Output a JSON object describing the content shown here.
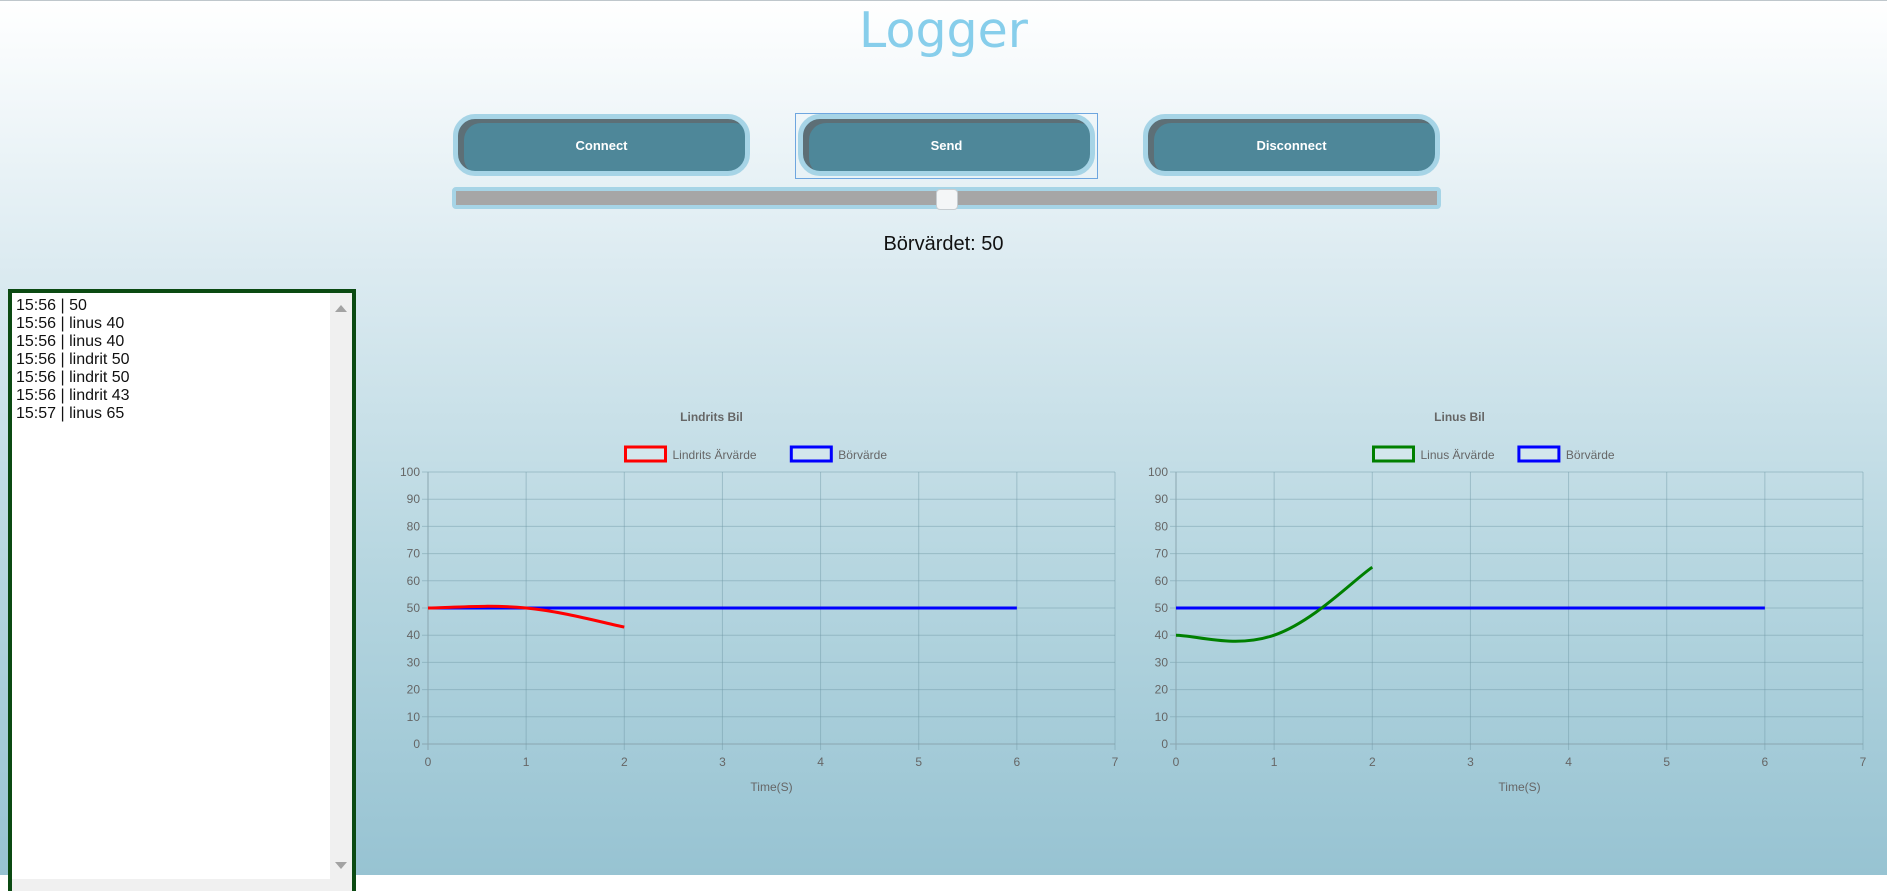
{
  "header": {
    "title": "Logger"
  },
  "controls": {
    "connect_label": "Connect",
    "send_label": "Send",
    "disconnect_label": "Disconnect",
    "slider_value": 50,
    "slider_min": 0,
    "slider_max": 100
  },
  "setpoint": {
    "text": "Börvärdet: 50"
  },
  "log": {
    "lines": [
      "15:56 | 50",
      "15:56 | linus 40",
      "15:56 | linus 40",
      "15:56 | lindrit 50",
      "15:56 | lindrit 50",
      "15:56 | lindrit 43",
      "15:57 | linus 65"
    ]
  },
  "colors": {
    "button_bg": "#4e8799",
    "button_border": "#a6d4e6",
    "title": "#87ceeb",
    "log_border": "#0b4a12",
    "lindrit": "#ff0000",
    "linus": "#008000",
    "borvarde": "#0000ff"
  },
  "chart_data": [
    {
      "type": "line",
      "title": "Lindrits Bil",
      "xlabel": "Time(S)",
      "ylabel": "",
      "xlim": [
        0,
        7
      ],
      "ylim": [
        0,
        100
      ],
      "xticks": [
        0,
        1,
        2,
        3,
        4,
        5,
        6,
        7
      ],
      "yticks": [
        0,
        10,
        20,
        30,
        40,
        50,
        60,
        70,
        80,
        90,
        100
      ],
      "grid": true,
      "legend": "top-center",
      "series": [
        {
          "name": "Lindrits Ärvärde",
          "color": "#ff0000",
          "x": [
            0,
            1,
            2
          ],
          "y": [
            50,
            50,
            43
          ]
        },
        {
          "name": "Börvärde",
          "color": "#0000ff",
          "x": [
            0,
            1,
            2,
            3,
            4,
            5,
            6
          ],
          "y": [
            50,
            50,
            50,
            50,
            50,
            50,
            50
          ]
        }
      ]
    },
    {
      "type": "line",
      "title": "Linus Bil",
      "xlabel": "Time(S)",
      "ylabel": "",
      "xlim": [
        0,
        7
      ],
      "ylim": [
        0,
        100
      ],
      "xticks": [
        0,
        1,
        2,
        3,
        4,
        5,
        6,
        7
      ],
      "yticks": [
        0,
        10,
        20,
        30,
        40,
        50,
        60,
        70,
        80,
        90,
        100
      ],
      "grid": true,
      "legend": "top-center",
      "series": [
        {
          "name": "Linus Ärvärde",
          "color": "#008000",
          "x": [
            0,
            1,
            2
          ],
          "y": [
            40,
            40,
            65
          ]
        },
        {
          "name": "Börvärde",
          "color": "#0000ff",
          "x": [
            0,
            1,
            2,
            3,
            4,
            5,
            6
          ],
          "y": [
            50,
            50,
            50,
            50,
            50,
            50,
            50
          ]
        }
      ]
    }
  ]
}
